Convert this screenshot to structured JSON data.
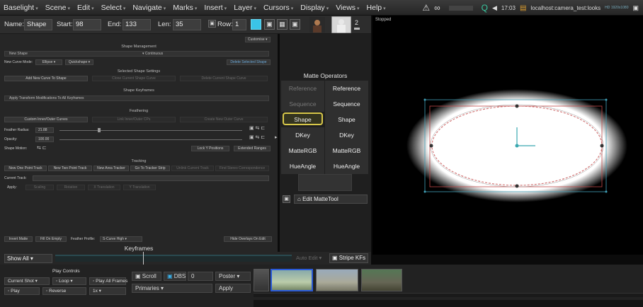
{
  "menubar": {
    "items": [
      "Baselight",
      "Scene",
      "Edit",
      "Select",
      "Navigate",
      "Marks",
      "Insert",
      "Layer",
      "Cursors",
      "Display",
      "Views",
      "Help"
    ],
    "clock": "17:03",
    "host": "localhost:camera_test:looks",
    "format": "HD 1920x1080"
  },
  "toolbar": {
    "name_label": "Name:",
    "name_value": "Shape",
    "start_label": "Start:",
    "start_value": "98",
    "end_label": "End:",
    "end_value": "133",
    "len_label": "Len:",
    "len_value": "35",
    "row_label": "Row:",
    "row_value": "1",
    "layer_count": "2"
  },
  "shape": {
    "customise": "Customise",
    "mgmt_title": "Shape Management",
    "shape_select": "New Shape",
    "continuous": "Continuous",
    "curve_mode_label": "New Curve Mode:",
    "curve_mode": "Ellipse",
    "quickshape": "Quickshape",
    "delete_selected": "Delete Selected Shape",
    "settings_title": "Selected Shape Settings",
    "add_curve": "Add New Curve To Shape",
    "clone_curve": "Clone Current Shape Curve",
    "delete_curve": "Delete Current Shape Curve",
    "keyframes_title": "Shape Keyframes",
    "apply_transform": "Apply Transform Modifications To All Keyframes",
    "feathering_title": "Feathering",
    "custom_curves": "Custom Inner/Outer Curves",
    "link_cps": "Link Inner/Outer CPs",
    "create_outer": "Create New Outer Curve",
    "radius_label": "Feather Radius:",
    "radius_value": "21.88",
    "opacity_label": "Opacity:",
    "opacity_value": "100.00",
    "motion_label": "Shape Motion:",
    "lock_y": "Lock Y Positions",
    "extended_ranges": "Extended Ranges"
  },
  "tracking": {
    "title": "Tracking",
    "buttons": [
      "New One Point Track",
      "New Two Point Track",
      "New Area Tracker",
      "Go To Tracker Strip"
    ],
    "dim_buttons": [
      "Unlink Current Track",
      "Find Stereo Correspondence"
    ],
    "current_track_label": "Current Track:",
    "apply_label": "Apply:",
    "apply_items": [
      "Scaling",
      "Rotation",
      "X Translation",
      "Y Translation"
    ]
  },
  "bottomleft": {
    "invert_matte": "Invert Matte",
    "fill_on_empty": "Fill On Empty",
    "feather_profile_label": "Feather Profile:",
    "feather_profile": "S-Curve High",
    "hide_overlays": "Hide Overlays On Edit"
  },
  "matte": {
    "title": "Matte Operators",
    "left": [
      "Reference",
      "Sequence",
      "Shape",
      "DKey",
      "MatteRGB",
      "HueAngle"
    ],
    "right": [
      "Reference",
      "Sequence",
      "Shape",
      "DKey",
      "MatteRGB",
      "HueAngle"
    ],
    "edit_tool": "Edit MatteTool"
  },
  "keyframes": {
    "title": "Keyframes",
    "show": "Show All",
    "auto_edit": "Auto Edit",
    "stripe": "Stripe KFs"
  },
  "viewer": {
    "status": "Stopped"
  },
  "playcontrols": {
    "title": "Play Controls",
    "shot": "Current Shot",
    "loop": "Loop",
    "play_all": "Play All Frames",
    "play": "Play",
    "reverse": "Reverse",
    "speed": "1x",
    "scroll": "Scroll",
    "dbs": "DBS",
    "dbs_value": "0",
    "poster": "Poster",
    "primaries": "Primaries",
    "apply": "Apply"
  },
  "colors": {
    "accent": "#1e90c8",
    "selected_border": "#d8c84a",
    "ellipse": "#d27878"
  }
}
